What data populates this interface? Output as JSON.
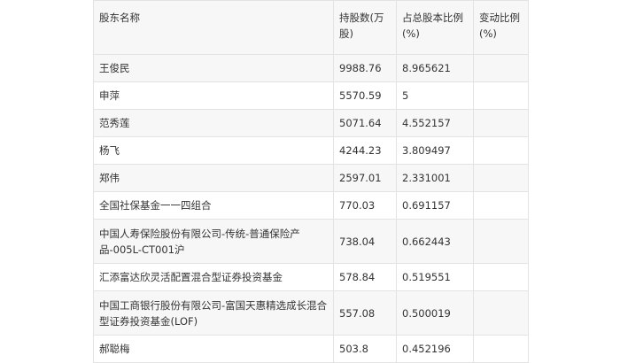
{
  "table": {
    "headers": [
      "股东名称",
      "持股数(万股)",
      "占总股本比例(%)",
      "变动比例(%)"
    ],
    "rows": [
      {
        "name": "王俊民",
        "shares": "9988.76",
        "ratio": "8.965621",
        "change": ""
      },
      {
        "name": "申萍",
        "shares": "5570.59",
        "ratio": "5",
        "change": ""
      },
      {
        "name": "范秀莲",
        "shares": "5071.64",
        "ratio": "4.552157",
        "change": ""
      },
      {
        "name": "杨飞",
        "shares": "4244.23",
        "ratio": "3.809497",
        "change": ""
      },
      {
        "name": "郑伟",
        "shares": "2597.01",
        "ratio": "2.331001",
        "change": ""
      },
      {
        "name": "全国社保基金一一四组合",
        "shares": "770.03",
        "ratio": "0.691157",
        "change": ""
      },
      {
        "name": "中国人寿保险股份有限公司-传统-普通保险产品-005L-CT001沪",
        "shares": "738.04",
        "ratio": "0.662443",
        "change": ""
      },
      {
        "name": "汇添富达欣灵活配置混合型证券投资基金",
        "shares": "578.84",
        "ratio": "0.519551",
        "change": ""
      },
      {
        "name": "中国工商银行股份有限公司-富国天惠精选成长混合型证券投资基金(LOF)",
        "shares": "557.08",
        "ratio": "0.500019",
        "change": ""
      },
      {
        "name": "郝聪梅",
        "shares": "503.8",
        "ratio": "0.452196",
        "change": ""
      }
    ]
  }
}
